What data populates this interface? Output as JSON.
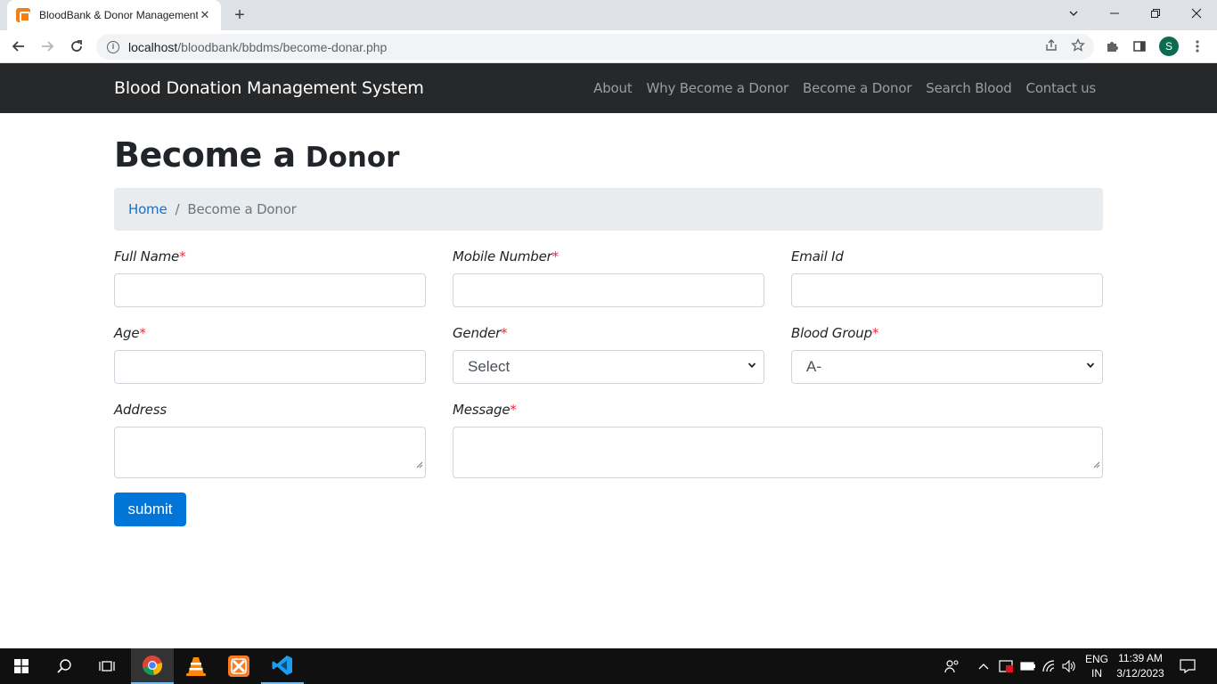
{
  "browser": {
    "tab_title": "BloodBank & Donor Management",
    "tab_close": "✕",
    "new_tab": "+",
    "url_host": "localhost",
    "url_path": "/bloodbank/bbdms/become-donar.php",
    "profile_initial": "S"
  },
  "navbar": {
    "brand": "Blood Donation Management System",
    "links": [
      "About",
      "Why Become a Donor",
      "Become a Donor",
      "Search Blood",
      "Contact us"
    ]
  },
  "page": {
    "title_bold": "Become a",
    "title_light": "Donor"
  },
  "breadcrumb": {
    "home": "Home",
    "separator": "/",
    "current": "Become a Donor"
  },
  "form": {
    "required_mark": "*",
    "full_name": {
      "label": "Full Name",
      "value": ""
    },
    "mobile": {
      "label": "Mobile Number",
      "value": ""
    },
    "email": {
      "label": "Email Id",
      "value": ""
    },
    "age": {
      "label": "Age",
      "value": ""
    },
    "gender": {
      "label": "Gender",
      "selected": "Select"
    },
    "blood_group": {
      "label": "Blood Group",
      "selected": "A-"
    },
    "address": {
      "label": "Address",
      "value": ""
    },
    "message": {
      "label": "Message",
      "value": ""
    },
    "submit": "submit"
  },
  "taskbar": {
    "lang_line1": "ENG",
    "lang_line2": "IN",
    "time": "11:39 AM",
    "date": "3/12/2023"
  },
  "colors": {
    "navbar_bg": "#272829",
    "submit_bg": "#0275d8",
    "required": "#dc3545",
    "link": "#1a6fc4"
  }
}
